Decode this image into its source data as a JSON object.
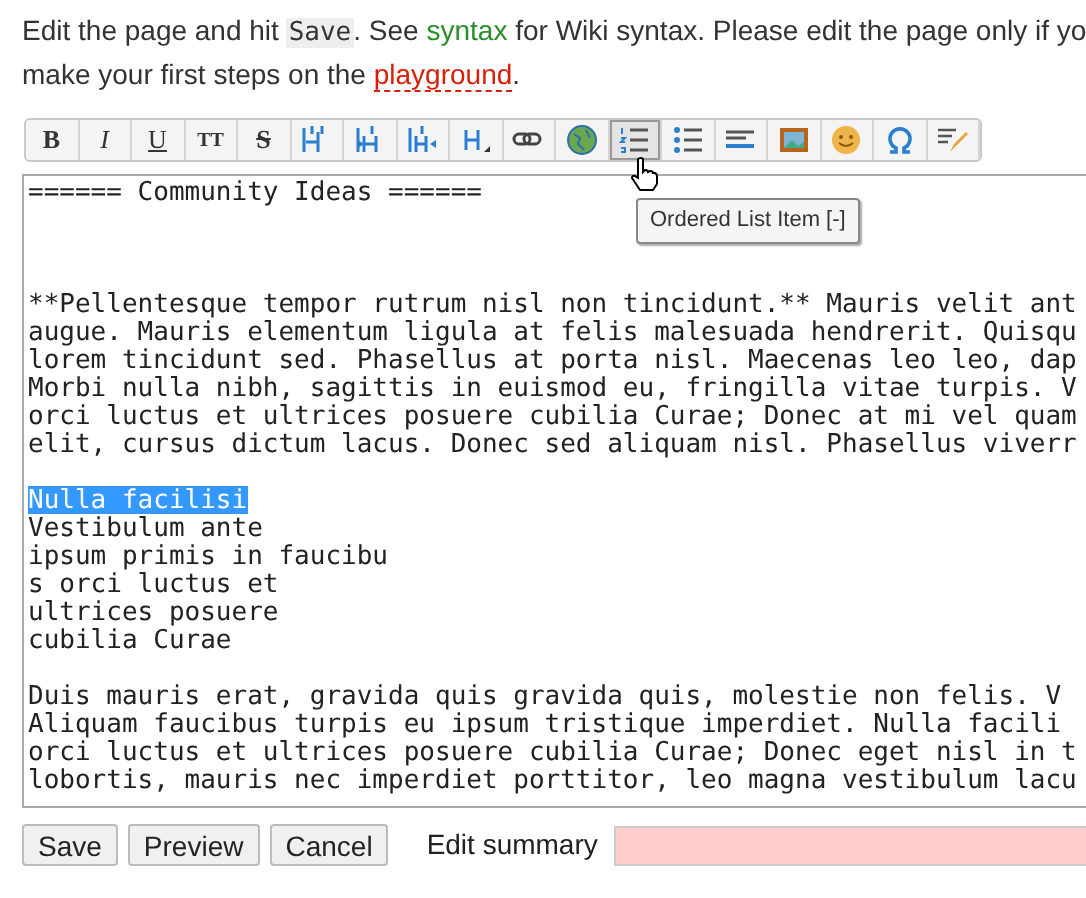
{
  "intro": {
    "line_1": {
      "before": "Edit the page and hit",
      "code": "Save",
      "middle": ". See",
      "link": "syntax",
      "after": "for Wiki syntax. Please edit the page only if yo"
    },
    "line_2": {
      "before": "make your first steps on the",
      "link": "playground",
      "after": "."
    }
  },
  "toolbar": [
    {
      "label": "B",
      "hovered": false
    },
    {
      "label": "I",
      "hovered": false
    },
    {
      "label": "U",
      "hovered": false
    },
    {
      "label": "TT",
      "hovered": false
    },
    {
      "label": "S",
      "hovered": false
    },
    {
      "hovered": false
    },
    {
      "hovered": false
    },
    {
      "hovered": false
    },
    {
      "hovered": false
    },
    {
      "hovered": false
    },
    {
      "hovered": false
    },
    {
      "hovered": true
    },
    {
      "hovered": false
    },
    {
      "hovered": false
    },
    {
      "hovered": false
    },
    {
      "hovered": false
    },
    {
      "hovered": false
    },
    {
      "hovered": false
    }
  ],
  "tooltip": "Ordered List Item [-]",
  "editor_blocks": [
    {
      "kind": "heading",
      "lines": [
        {
          "text": "====== Community Ideas ======",
          "selected": false
        }
      ]
    },
    {
      "kind": "paragraph",
      "lines": [
        {
          "text": "**Pellentesque tempor rutrum nisl non tincidunt.** Mauris velit ant",
          "selected": false
        },
        {
          "text": "augue. Mauris elementum ligula at felis malesuada hendrerit. Quisqu",
          "selected": false
        },
        {
          "text": "lorem tincidunt sed. Phasellus at porta nisl. Maecenas leo leo, dap",
          "selected": false
        },
        {
          "text": "Morbi nulla nibh, sagittis in euismod eu, fringilla vitae turpis. V",
          "selected": false
        },
        {
          "text": "orci luctus et ultrices posuere cubilia Curae; Donec at mi vel quam",
          "selected": false
        },
        {
          "text": "elit, cursus dictum lacus. Donec sed aliquam nisl. Phasellus viverr",
          "selected": false
        }
      ]
    },
    {
      "kind": "paragraph",
      "lines": [
        {
          "text": "Nulla facilisi",
          "selected": true
        },
        {
          "text": "Vestibulum ante",
          "selected": false
        },
        {
          "text": "ipsum primis in faucibu",
          "selected": false
        },
        {
          "text": "s orci luctus et",
          "selected": false
        },
        {
          "text": "ultrices posuere",
          "selected": false
        },
        {
          "text": "cubilia Curae",
          "selected": false
        }
      ]
    },
    {
      "kind": "paragraph",
      "lines": [
        {
          "text": "Duis mauris erat, gravida quis gravida quis, molestie non felis. V",
          "selected": false
        },
        {
          "text": "Aliquam faucibus turpis eu ipsum tristique imperdiet. Nulla facili",
          "selected": false
        },
        {
          "text": "orci luctus et ultrices posuere cubilia Curae; Donec eget nisl in t",
          "selected": false
        },
        {
          "text": "lobortis, mauris nec imperdiet porttitor, leo magna vestibulum lacu",
          "selected": false
        }
      ]
    }
  ],
  "buttons": [
    "Save",
    "Preview",
    "Cancel"
  ],
  "summary_label": "Edit summary"
}
